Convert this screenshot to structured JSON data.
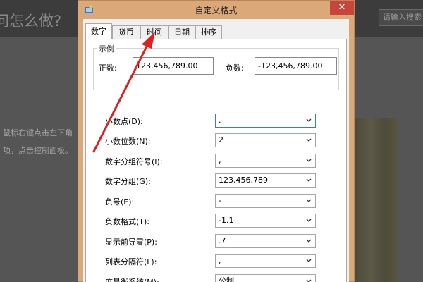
{
  "background": {
    "title": "问怎么做?",
    "search_placeholder": "请输入搜索",
    "line1": "鼠标右键点击左下角",
    "line2": "项，点击控制面板。"
  },
  "dialog": {
    "title": "自定义格式",
    "close_label": "✕",
    "tabs": [
      {
        "label": "数字",
        "active": true
      },
      {
        "label": "货币",
        "active": false
      },
      {
        "label": "时间",
        "active": false
      },
      {
        "label": "日期",
        "active": false
      },
      {
        "label": "排序",
        "active": false
      }
    ],
    "sample": {
      "caption": "示例",
      "positive_label": "正数:",
      "positive_value": "123,456,789.00",
      "negative_label": "负数:",
      "negative_value": "-123,456,789.00"
    },
    "settings": [
      {
        "label": "小数点(D):",
        "value": "."
      },
      {
        "label": "小数位数(N):",
        "value": "2"
      },
      {
        "label": "数字分组符号(I):",
        "value": ","
      },
      {
        "label": "数字分组(G):",
        "value": "123,456,789"
      },
      {
        "label": "负号(E):",
        "value": "-"
      },
      {
        "label": "负数格式(T):",
        "value": "-1.1"
      },
      {
        "label": "显示前导零(P):",
        "value": ".7"
      },
      {
        "label": "列表分隔符(L):",
        "value": ","
      },
      {
        "label": "度量衡系统(M):",
        "value": "公制"
      }
    ]
  },
  "annotation": {
    "arrow_color": "#e02020"
  }
}
